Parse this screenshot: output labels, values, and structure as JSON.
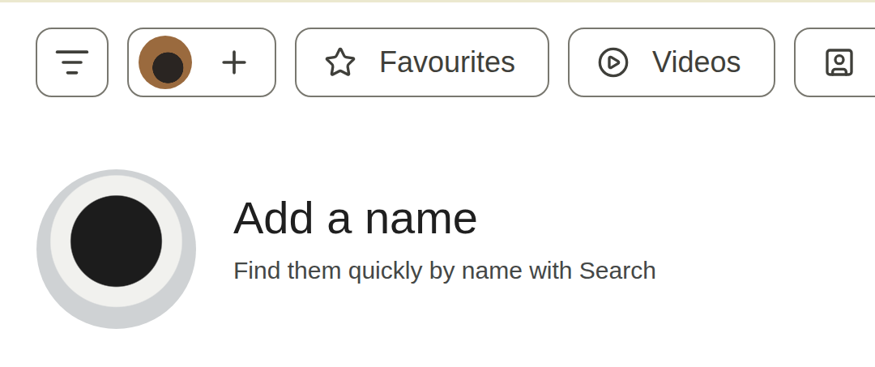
{
  "chips": [
    {
      "kind": "filter",
      "label": "",
      "selected": false
    },
    {
      "kind": "avatar-add",
      "label": "",
      "selected": false
    },
    {
      "kind": "favourites",
      "label": "Favourites",
      "selected": false
    },
    {
      "kind": "videos",
      "label": "Videos",
      "selected": false
    },
    {
      "kind": "portrait",
      "label": "",
      "selected": false
    }
  ],
  "person": {
    "title": "Add a name",
    "subtitle": "Find them quickly by name with Search"
  }
}
